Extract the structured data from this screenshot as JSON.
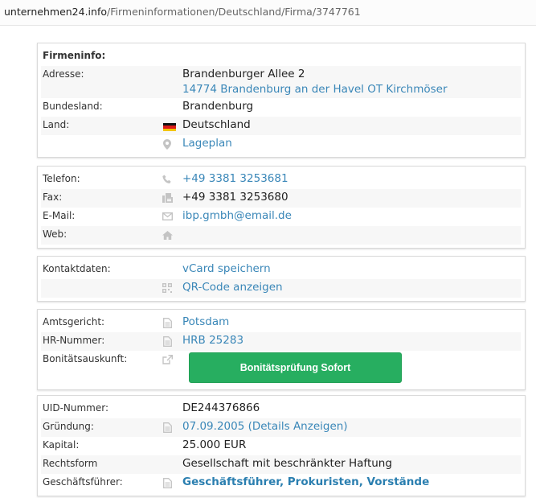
{
  "url": {
    "host": "unternehmen24.info",
    "path": "/Firmeninformationen/Deutschland/Firma/3747761"
  },
  "colors": {
    "link": "#3a87b8",
    "button": "#27ae60",
    "icon": "#bfbfbf"
  },
  "firmeninfo": {
    "heading": "Firmeninfo:",
    "adresse_label": "Adresse:",
    "street": "Brandenburger Allee 2",
    "city": "14774 Brandenburg an der Havel OT Kirchmöser",
    "bundesland_label": "Bundesland:",
    "bundesland": "Brandenburg",
    "land_label": "Land:",
    "land": "Deutschland",
    "lageplan": "Lageplan"
  },
  "contact": {
    "telefon_label": "Telefon:",
    "telefon": "+49 3381 3253681",
    "fax_label": "Fax:",
    "fax": "+49 3381 3253680",
    "email_label": "E-Mail:",
    "email": "ibp.gmbh@email.de",
    "web_label": "Web:"
  },
  "kontaktdaten": {
    "label": "Kontaktdaten:",
    "vcard": "vCard speichern",
    "qr": "QR-Code anzeigen"
  },
  "register": {
    "amtsgericht_label": "Amtsgericht:",
    "amtsgericht": "Potsdam",
    "hr_label": "HR-Nummer:",
    "hr": "HRB 25283",
    "bonitaet_label": "Bonitätsauskunft:",
    "button": "Bonitätsprüfung Sofort"
  },
  "details": {
    "uid_label": "UID-Nummer:",
    "uid": "DE244376866",
    "gruendung_label": "Gründung:",
    "gruendung": "07.09.2005 (Details Anzeigen)",
    "kapital_label": "Kapital:",
    "kapital": "25.000 EUR",
    "rechtsform_label": "Rechtsform",
    "rechtsform": "Gesellschaft mit beschränkter Haftung",
    "gf_label": "Geschäftsführer:",
    "gf": "Geschäftsführer, Prokuristen, Vorstände"
  }
}
